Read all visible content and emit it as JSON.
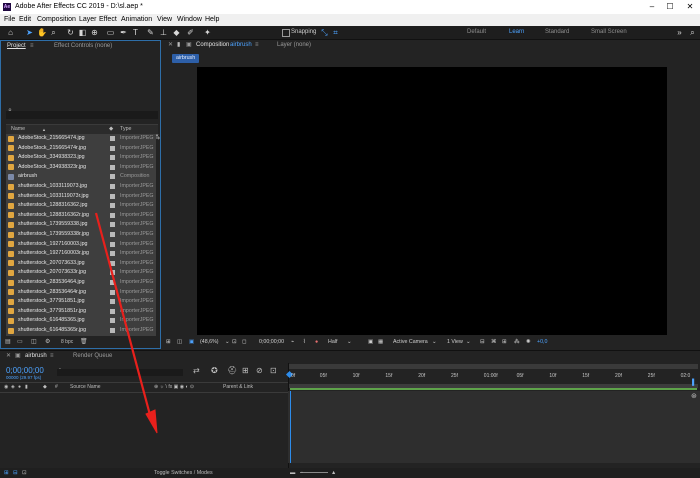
{
  "window": {
    "app_icon": "Ae",
    "title": "Adobe After Effects CC 2019 - D:\\sl.aep *"
  },
  "menu": [
    "File",
    "Edit",
    "Composition",
    "Layer",
    "Effect",
    "Animation",
    "View",
    "Window",
    "Help"
  ],
  "toolbar": {
    "snapping_label": "Snapping"
  },
  "workspaces": {
    "items": [
      "Default",
      "Learn",
      "Standard",
      "Small Screen"
    ],
    "active": "Learn"
  },
  "project_panel": {
    "tab_project": "Project",
    "tab_effect_controls": "Effect Controls (none)",
    "col_name": "Name",
    "col_type": "Type",
    "items": [
      {
        "name": "AdobeStock_215665474.jpg",
        "type": "ImporterJPEG",
        "kind": "image"
      },
      {
        "name": "AdobeStock_215665474r.jpg",
        "type": "ImporterJPEG",
        "kind": "image"
      },
      {
        "name": "AdobeStock_334938323.jpg",
        "type": "ImporterJPEG",
        "kind": "image"
      },
      {
        "name": "AdobeStock_334938323r.jpg",
        "type": "ImporterJPEG",
        "kind": "image"
      },
      {
        "name": "airbrush",
        "type": "Composition",
        "kind": "comp"
      },
      {
        "name": "shutterstock_1033119073.jpg",
        "type": "ImporterJPEG",
        "kind": "image"
      },
      {
        "name": "shutterstock_1033119073r.jpg",
        "type": "ImporterJPEG",
        "kind": "image"
      },
      {
        "name": "shutterstock_1288316362.jpg",
        "type": "ImporterJPEG",
        "kind": "image"
      },
      {
        "name": "shutterstock_1288316362r.jpg",
        "type": "ImporterJPEG",
        "kind": "image"
      },
      {
        "name": "shutterstock_1739559338.jpg",
        "type": "ImporterJPEG",
        "kind": "image"
      },
      {
        "name": "shutterstock_1739559338r.jpg",
        "type": "ImporterJPEG",
        "kind": "image"
      },
      {
        "name": "shutterstock_1927160003.jpg",
        "type": "ImporterJPEG",
        "kind": "image"
      },
      {
        "name": "shutterstock_1927160003r.jpg",
        "type": "ImporterJPEG",
        "kind": "image"
      },
      {
        "name": "shutterstock_207073633.jpg",
        "type": "ImporterJPEG",
        "kind": "image"
      },
      {
        "name": "shutterstock_207073633r.jpg",
        "type": "ImporterJPEG",
        "kind": "image"
      },
      {
        "name": "shutterstock_283536464.jpg",
        "type": "ImporterJPEG",
        "kind": "image"
      },
      {
        "name": "shutterstock_283536464r.jpg",
        "type": "ImporterJPEG",
        "kind": "image"
      },
      {
        "name": "shutterstock_377951851.jpg",
        "type": "ImporterJPEG",
        "kind": "image"
      },
      {
        "name": "shutterstock_377951851r.jpg",
        "type": "ImporterJPEG",
        "kind": "image"
      },
      {
        "name": "shutterstock_616485365.jpg",
        "type": "ImporterJPEG",
        "kind": "image"
      },
      {
        "name": "shutterstock_616485365r.jpg",
        "type": "ImporterJPEG",
        "kind": "image"
      }
    ],
    "bpc": "8 bpc"
  },
  "comp_panel": {
    "tab_composition": "Composition",
    "tab_composition_name": "airbrush",
    "tab_layer": "Layer (none)",
    "breadcrumb": "airbrush",
    "zoom": "(48,6%)",
    "timecode": "0;00;00;00",
    "resolution": "Half",
    "camera": "Active Camera",
    "views": "1 View",
    "exposure": "+0,0"
  },
  "timeline": {
    "tab_comp": "airbrush",
    "tab_render_queue": "Render Queue",
    "timecode": "0;00;00;00",
    "frame_info": "00000 (29.97 fps)",
    "col_source_name": "Source Name",
    "col_parent": "Parent & Link",
    "ruler": [
      "0f",
      "05f",
      "10f",
      "15f",
      "20f",
      "25f",
      "01:00f",
      "05f",
      "10f",
      "15f",
      "20f",
      "25f",
      "02:0"
    ],
    "toggle_label": "Toggle Switches / Modes"
  },
  "colors": {
    "accent": "#2d8ceb",
    "annotation_arrow": "#e8201c",
    "label_yellow": "#e0a640"
  }
}
